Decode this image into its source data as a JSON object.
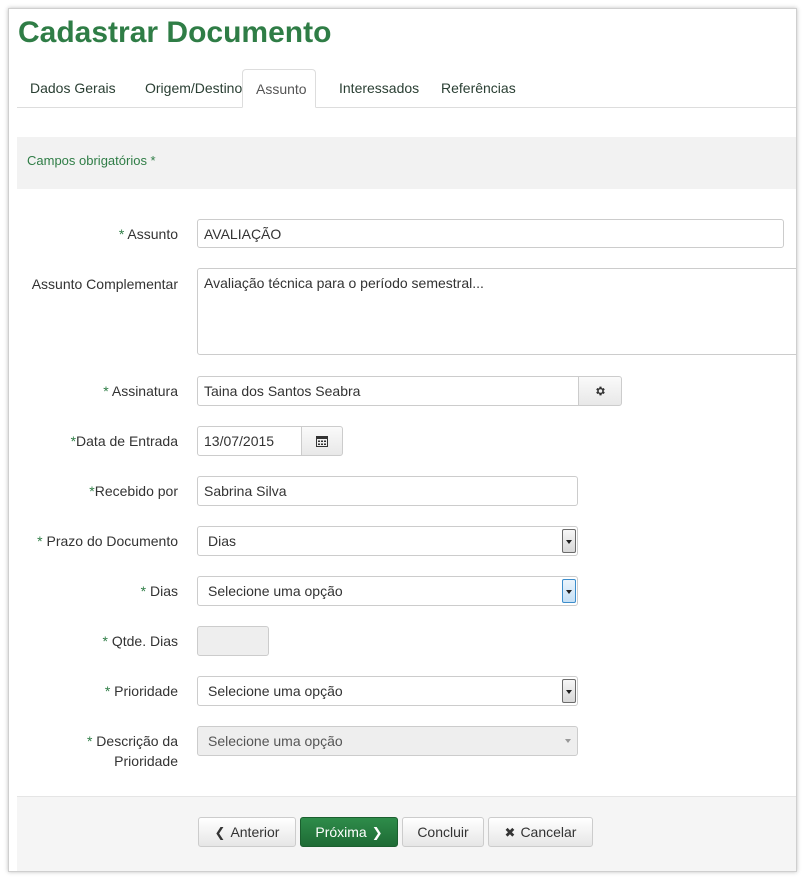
{
  "page": {
    "title": "Cadastrar Documento"
  },
  "tabs": [
    {
      "label": "Dados Gerais"
    },
    {
      "label": "Origem/Destino"
    },
    {
      "label": "Assunto"
    },
    {
      "label": "Interessados"
    },
    {
      "label": "Referências"
    }
  ],
  "required_note": "Campos obrigatórios *",
  "form": {
    "assunto": {
      "star": "*",
      "label": " Assunto",
      "value": "AVALIAÇÃO"
    },
    "assunto_complementar": {
      "label": "Assunto Complementar",
      "value": "Avaliação técnica para o período semestral..."
    },
    "assinatura": {
      "star": "*",
      "label": " Assinatura",
      "value": "Taina dos Santos Seabra",
      "addon_icon": "gear-icon"
    },
    "data_entrada": {
      "star": "*",
      "label": "Data de Entrada",
      "value": "13/07/2015",
      "addon_icon": "calendar-icon"
    },
    "recebido_por": {
      "star": "*",
      "label": "Recebido por",
      "value": "Sabrina Silva"
    },
    "prazo_documento": {
      "star": "*",
      "label": " Prazo do Documento",
      "value": "Dias"
    },
    "dias": {
      "star": "*",
      "label": " Dias",
      "value": "Selecione uma opção"
    },
    "qtde_dias": {
      "star": "*",
      "label": " Qtde. Dias",
      "value": ""
    },
    "prioridade": {
      "star": "*",
      "label": " Prioridade",
      "value": "Selecione uma opção"
    },
    "descricao_prioridade": {
      "star": "*",
      "label_line1": " Descrição da",
      "label_line2": "Prioridade",
      "value": "Selecione uma opção"
    }
  },
  "footer": {
    "anterior": "Anterior",
    "proxima": "Próxima",
    "concluir": "Concluir",
    "cancelar": "Cancelar"
  },
  "colors": {
    "brand_green": "#2f7d46",
    "primary_button": "#1e6b35"
  }
}
